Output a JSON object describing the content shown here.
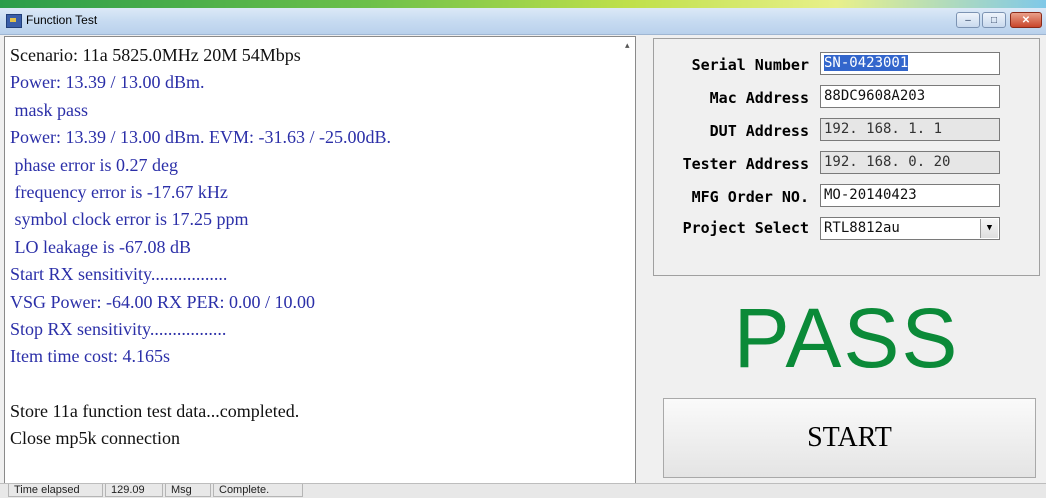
{
  "window": {
    "title": "Function Test",
    "minimize_glyph": "–",
    "maximize_glyph": "□",
    "close_glyph": "✕"
  },
  "log": {
    "lines": [
      {
        "text": "Scenario: 11a 5825.0MHz 20M 54Mbps",
        "color": "#111111"
      },
      {
        "text": "Power: 13.39 / 13.00 dBm.",
        "color": "#2b2fa8"
      },
      {
        "text": " mask pass",
        "color": "#2b2fa8"
      },
      {
        "text": "Power: 13.39 / 13.00 dBm. EVM: -31.63 / -25.00dB.",
        "color": "#2b2fa8"
      },
      {
        "text": " phase error is 0.27 deg",
        "color": "#2b2fa8"
      },
      {
        "text": " frequency error is -17.67 kHz",
        "color": "#2b2fa8"
      },
      {
        "text": " symbol clock error is 17.25 ppm",
        "color": "#2b2fa8"
      },
      {
        "text": " LO leakage is -67.08 dB",
        "color": "#2b2fa8"
      },
      {
        "text": "Start RX sensitivity.................",
        "color": "#2b2fa8"
      },
      {
        "text": "VSG Power: -64.00 RX PER: 0.00 / 10.00",
        "color": "#2b2fa8"
      },
      {
        "text": "Stop RX sensitivity.................",
        "color": "#2b2fa8"
      },
      {
        "text": "Item time cost: 4.165s",
        "color": "#2b2fa8"
      },
      {
        "text": "",
        "color": "#111111"
      },
      {
        "text": "Store 11a function test data...completed.",
        "color": "#111111"
      },
      {
        "text": "Close mp5k connection",
        "color": "#111111"
      }
    ]
  },
  "form": {
    "serial_number": {
      "label": "Serial Number",
      "value": "SN-0423001"
    },
    "mac_address": {
      "label": "Mac Address",
      "value": "88DC9608A203"
    },
    "dut_address": {
      "label": "DUT Address",
      "value": "192. 168. 1. 1"
    },
    "tester_address": {
      "label": "Tester Address",
      "value": "192. 168. 0. 20"
    },
    "mfg_order": {
      "label": "MFG Order NO.",
      "value": "MO-20140423"
    },
    "project_select": {
      "label": "Project Select",
      "value": "RTL8812au"
    }
  },
  "result": {
    "text": "PASS",
    "color": "#0b8a38"
  },
  "start_button": {
    "label": "START"
  },
  "status": {
    "time_label": "Time elapsed",
    "time_value": "129.09",
    "msg_label": "Msg",
    "msg_value": "Complete."
  }
}
